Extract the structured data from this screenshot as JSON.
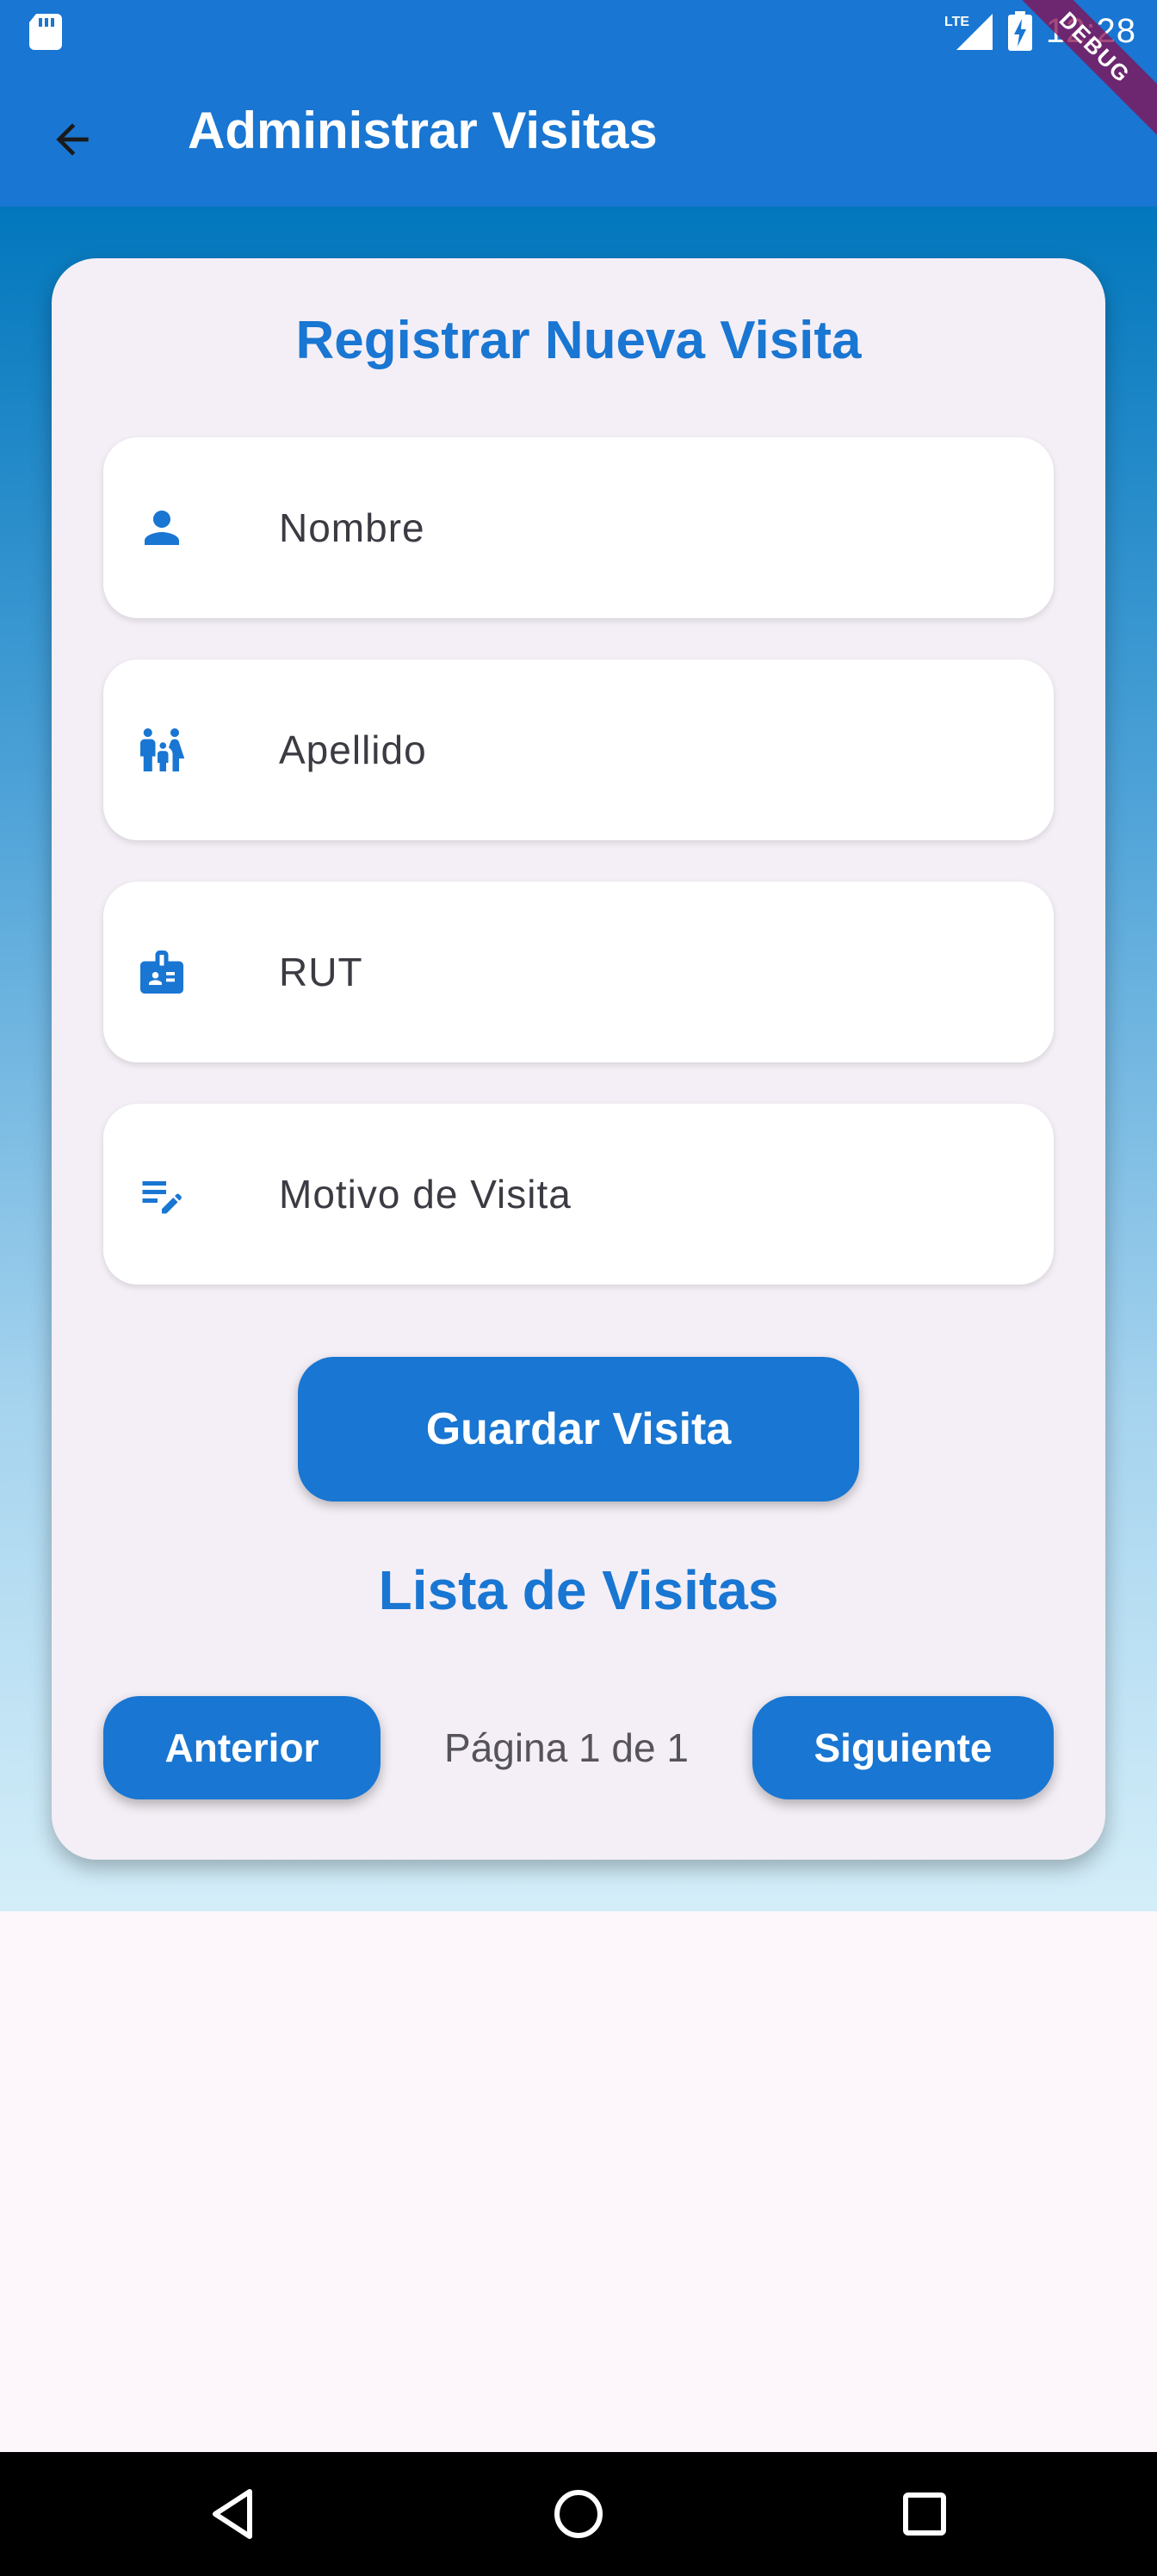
{
  "status_bar": {
    "time": "12:28",
    "network_label": "LTE",
    "icons": [
      "sd-card-icon",
      "signal-icon",
      "battery-charging-icon"
    ]
  },
  "debug_banner": "DEBUG",
  "app_bar": {
    "title": "Administrar Visitas",
    "back_icon": "arrow-back-icon"
  },
  "form": {
    "title": "Registrar Nueva Visita",
    "fields": [
      {
        "label": "Nombre",
        "icon": "person-icon"
      },
      {
        "label": "Apellido",
        "icon": "family-icon"
      },
      {
        "label": "RUT",
        "icon": "badge-icon"
      },
      {
        "label": "Motivo de Visita",
        "icon": "edit-note-icon"
      }
    ],
    "save_label": "Guardar Visita"
  },
  "list": {
    "title": "Lista de Visitas",
    "prev_label": "Anterior",
    "next_label": "Siguiente",
    "page_text": "Página 1 de 1"
  },
  "colors": {
    "primary": "#1976D2",
    "card_bg": "#F4EFF6",
    "gradient_top": "#0277BD",
    "gradient_bottom": "#D4EEF9"
  },
  "nav_bar": {
    "buttons": [
      "back-triangle-icon",
      "home-circle-icon",
      "recents-square-icon"
    ]
  }
}
